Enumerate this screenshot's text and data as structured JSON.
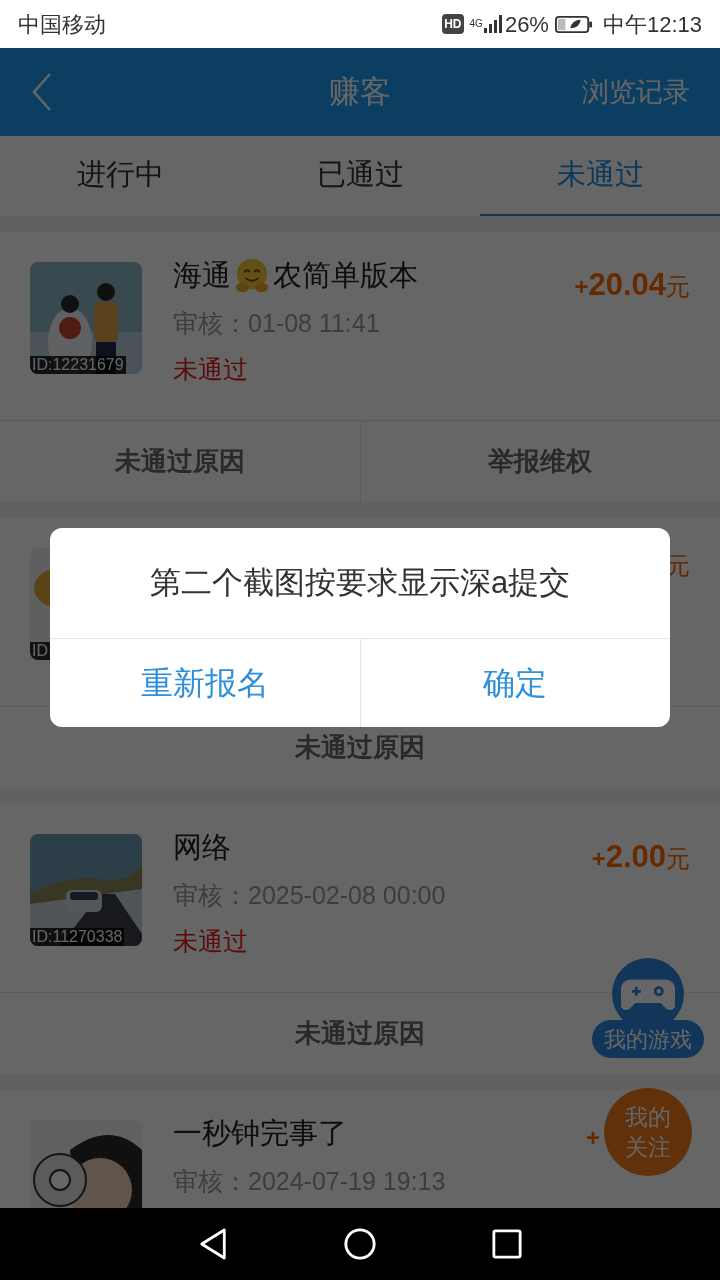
{
  "status_bar": {
    "carrier": "中国移动",
    "hd": "HD",
    "network": "4G",
    "battery": "26%",
    "time": "中午12:13"
  },
  "header": {
    "title": "赚客",
    "action": "浏览记录"
  },
  "tabs": [
    {
      "label": "进行中",
      "selected": false
    },
    {
      "label": "已通过",
      "selected": false
    },
    {
      "label": "未通过",
      "selected": true
    }
  ],
  "tasks": [
    {
      "title": [
        {
          "kind": "text",
          "text": "海通"
        },
        {
          "kind": "emoji"
        },
        {
          "kind": "text",
          "text": "农简单版本"
        }
      ],
      "review": "审核：01-08 11:41",
      "status": "未通过",
      "sign": "+",
      "amount": "20.04",
      "unit": "元",
      "id": "ID:12231679",
      "actions": [
        "未通过原因",
        "举报维权"
      ]
    },
    {
      "unit": "元",
      "id": "ID",
      "actions": [
        "未通过原因"
      ]
    },
    {
      "title": [
        {
          "kind": "text",
          "text": "网络"
        }
      ],
      "review": "审核：2025-02-08 00:00",
      "status": "未通过",
      "sign": "+",
      "amount": "2.00",
      "unit": "元",
      "id": "ID:11270338",
      "actions": [
        "未通过原因"
      ]
    },
    {
      "title": [
        {
          "kind": "text",
          "text": "一秒钟完事了"
        }
      ],
      "review": "审核：2024-07-19 19:13",
      "sign": "+"
    }
  ],
  "floating": {
    "games": "我的游戏",
    "follow": "我的关注"
  },
  "dialog": {
    "message": "第二个截图按要求显示深a提交",
    "buttons": [
      "重新报名",
      "确定"
    ]
  }
}
